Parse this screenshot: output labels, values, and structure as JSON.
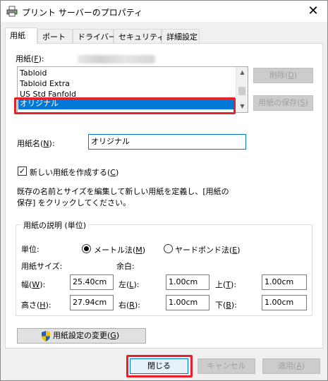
{
  "window": {
    "title": "プリント サーバーのプロパティ",
    "close_glyph": "✕"
  },
  "tabs": [
    {
      "label": "用紙",
      "active": true
    },
    {
      "label": "ポート",
      "active": false
    },
    {
      "label": "ドライバー",
      "active": false
    },
    {
      "label": "セキュリティ",
      "active": false
    },
    {
      "label": "詳細設定",
      "active": false
    }
  ],
  "forms": {
    "label_pre": "用紙(",
    "label_key": "F",
    "label_post": "):",
    "items": [
      "Tabloid",
      "Tabloid Extra",
      "US Std Fanfold",
      "オリジナル"
    ],
    "selected": "オリジナル",
    "delete_pre": "削除(",
    "delete_key": "D",
    "delete_post": ")",
    "save_pre": "用紙の保存(",
    "save_key": "S",
    "save_post": ")"
  },
  "form_name": {
    "label_pre": "用紙名(",
    "label_key": "N",
    "label_post": "):",
    "value": "オリジナル"
  },
  "create_new": {
    "label_pre": "新しい用紙を作成する(",
    "label_key": "C",
    "label_post": ")",
    "checked": true
  },
  "instructions": {
    "line1": "既存の名前とサイズを編集して新しい用紙を定義し、[用紙の",
    "line2": "保存] をクリックしてください。"
  },
  "description": {
    "group_title": "用紙の説明 (単位)",
    "unit_label": "単位:",
    "metric_pre": "メートル法(",
    "metric_key": "M",
    "metric_post": ")",
    "metric_selected": true,
    "english_pre": "ヤードポンド法(",
    "english_key": "E",
    "english_post": ")",
    "paper_size_label": "用紙サイズ:",
    "margins_label": "余白:",
    "width_pre": "幅(",
    "width_key": "W",
    "width_post": "):",
    "width_value": "25.40cm",
    "height_pre": "高さ(",
    "height_key": "H",
    "height_post": "):",
    "height_value": "27.94cm",
    "left_pre": "左(",
    "left_key": "L",
    "left_post": "):",
    "left_value": "1.00cm",
    "right_pre": "右(",
    "right_key": "R",
    "right_post": "):",
    "right_value": "1.00cm",
    "top_pre": "上(",
    "top_key": "T",
    "top_post": "):",
    "top_value": "1.00cm",
    "bottom_pre": "下(",
    "bottom_key": "B",
    "bottom_post": "):",
    "bottom_value": "1.00cm"
  },
  "change_settings": {
    "pre": "用紙設定の変更(",
    "key": "G",
    "post": ")",
    "icon": "uac-shield-icon"
  },
  "footer": {
    "close_pre": "閉じる",
    "cancel_label": "キャンセル",
    "apply_pre": "適用(",
    "apply_key": "A",
    "apply_post": ")"
  },
  "colors": {
    "selection": "#0078d7",
    "annotation_red": "#e8202a",
    "shield_blue": "#1f5fbf",
    "shield_yellow": "#f3c300"
  }
}
